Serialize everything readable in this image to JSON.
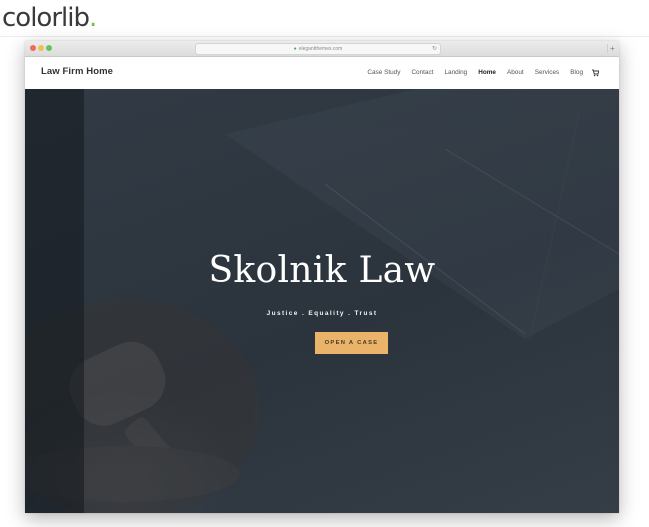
{
  "brand": {
    "name": "colorlib",
    "dot": "."
  },
  "browser": {
    "url": "elegantthemes.com",
    "lock_icon": "lock-icon",
    "reload_icon": "reload-icon",
    "new_tab_symbol": "+"
  },
  "site": {
    "title": "Law Firm Home",
    "nav": [
      {
        "label": "Case Study"
      },
      {
        "label": "Contact"
      },
      {
        "label": "Landing"
      },
      {
        "label": "Home",
        "active": true
      },
      {
        "label": "About"
      },
      {
        "label": "Services"
      },
      {
        "label": "Blog"
      }
    ],
    "cart_icon": "cart-icon"
  },
  "hero": {
    "title": "Skolnik Law",
    "tagline": "Justice . Equality . Trust",
    "cta_label": "OPEN A CASE"
  },
  "colors": {
    "brand_dot": "#6cc24a",
    "hero_bg": "#2e3640",
    "cta_bg": "#eab36a"
  }
}
